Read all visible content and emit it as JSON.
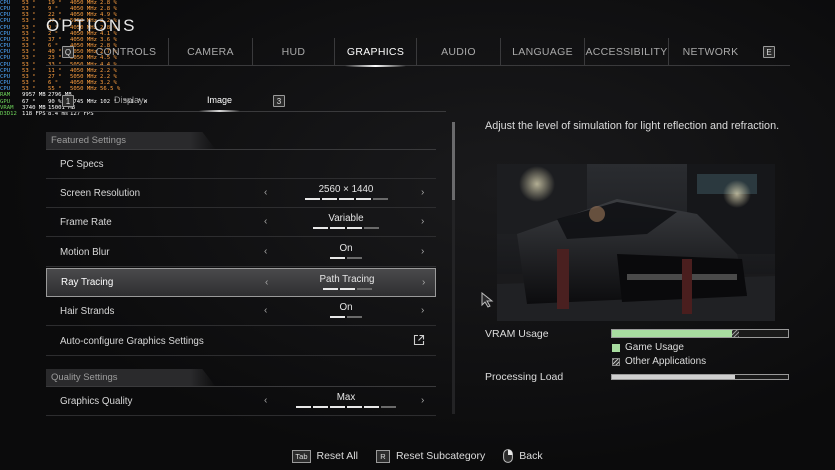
{
  "header": {
    "title": "OPTIONS",
    "tabs": [
      {
        "label": "CONTROLS",
        "active": false
      },
      {
        "label": "CAMERA",
        "active": false
      },
      {
        "label": "HUD",
        "active": false
      },
      {
        "label": "GRAPHICS",
        "active": true
      },
      {
        "label": "AUDIO",
        "active": false
      },
      {
        "label": "LANGUAGE",
        "active": false
      },
      {
        "label": "ACCESSIBILITY",
        "active": false
      },
      {
        "label": "NETWORK",
        "active": false
      }
    ],
    "key_prev": "Q",
    "key_next": "E"
  },
  "subtabs": {
    "display": "Display",
    "image": "Image",
    "key_prev": "1",
    "key_next": "3"
  },
  "sections": {
    "featured": "Featured Settings",
    "quality": "Quality Settings"
  },
  "settings": [
    {
      "label": "PC Specs",
      "value": "",
      "pips": 0,
      "on": 0
    },
    {
      "label": "Screen Resolution",
      "value": "2560 × 1440",
      "pips": 5,
      "on": 4
    },
    {
      "label": "Frame Rate",
      "value": "Variable",
      "pips": 4,
      "on": 3
    },
    {
      "label": "Motion Blur",
      "value": "On",
      "pips": 2,
      "on": 1
    },
    {
      "label": "Ray Tracing",
      "value": "Path Tracing",
      "pips": 3,
      "on": 2
    },
    {
      "label": "Hair Strands",
      "value": "On",
      "pips": 2,
      "on": 1
    },
    {
      "label": "Auto-configure Graphics Settings",
      "value": "",
      "pips": 0,
      "on": 0
    }
  ],
  "quality_settings": [
    {
      "label": "Graphics Quality",
      "value": "Max",
      "pips": 6,
      "on": 5
    }
  ],
  "description": "Adjust the level of simulation for light reflection and refraction.",
  "vram": {
    "label": "VRAM Usage",
    "game_fraction": 0.68,
    "other_fraction": 0.04,
    "legend_game": "Game Usage",
    "legend_other": "Other Applications"
  },
  "processing": {
    "label": "Processing Load",
    "fraction": 0.7
  },
  "footer": {
    "reset_all_key": "Tab",
    "reset_all": "Reset All",
    "reset_sub_key": "R",
    "reset_sub": "Reset Subcategory",
    "back": "Back"
  },
  "colors": {
    "accent_green": "#a8dca0",
    "overlay_name_blue": "#4fa9ff",
    "overlay_value_orange": "#ffa040",
    "overlay_name_green": "#6ed35a"
  },
  "overlay": [
    {
      "name": "CPU",
      "cols": [
        "53 °",
        "19 °",
        "4050 MHz",
        "2.8 %"
      ]
    },
    {
      "name": "CPU",
      "cols": [
        "53 °",
        "9 °",
        "4050 MHz",
        "2.8 %"
      ]
    },
    {
      "name": "CPU",
      "cols": [
        "53 °",
        "22 °",
        "4050 MHz",
        "4.9 %"
      ]
    },
    {
      "name": "CPU",
      "cols": [
        "53 °",
        "27 °",
        "5050 MHz",
        "2.2 %"
      ]
    },
    {
      "name": "CPU",
      "cols": [
        "53 °",
        "9 °",
        "4050 MHz",
        "2.8 %"
      ]
    },
    {
      "name": "CPU",
      "cols": [
        "53 °",
        "2 °",
        "4050 MHz",
        "4.1 %"
      ]
    },
    {
      "name": "CPU",
      "cols": [
        "53 °",
        "37 °",
        "4050 MHz",
        "3.6 %"
      ]
    },
    {
      "name": "CPU",
      "cols": [
        "53 °",
        "6 °",
        "4050 MHz",
        "2.8 %"
      ]
    },
    {
      "name": "CPU",
      "cols": [
        "53 °",
        "40 °",
        "4050 MHz",
        "2.7 %"
      ]
    },
    {
      "name": "CPU",
      "cols": [
        "53 °",
        "23 °",
        "5050 MHz",
        "4.5 %"
      ]
    },
    {
      "name": "CPU",
      "cols": [
        "53 °",
        "33 °",
        "5050 MHz",
        "4.4 %"
      ]
    },
    {
      "name": "CPU",
      "cols": [
        "53 °",
        "11 °",
        "4050 MHz",
        "2.2 %"
      ]
    },
    {
      "name": "CPU",
      "cols": [
        "53 °",
        "27 °",
        "5050 MHz",
        "2.2 %"
      ]
    },
    {
      "name": "CPU",
      "cols": [
        "53 °",
        "6 °",
        "4050 MHz",
        "3.2 %"
      ]
    },
    {
      "name": "CPU",
      "cols": [
        "53 °",
        "55 °",
        "5050 MHz",
        "56.5 %"
      ]
    },
    {
      "name": "RAM",
      "cols": [
        "9957 MB",
        "2796 MB",
        "",
        ""
      ],
      "alt": true
    },
    {
      "name": "GPU",
      "cols": [
        "67 °",
        "90 %",
        "2745 MHz",
        "102 °  361.7 W"
      ],
      "alt": true
    },
    {
      "name": "VRAM",
      "cols": [
        "3740 MB",
        "15001 MB",
        "",
        ""
      ],
      "alt": true
    },
    {
      "name": "D3D12",
      "cols": [
        "118 FPS",
        "8.4 ms",
        "127 FPS",
        ""
      ],
      "alt": true
    }
  ]
}
